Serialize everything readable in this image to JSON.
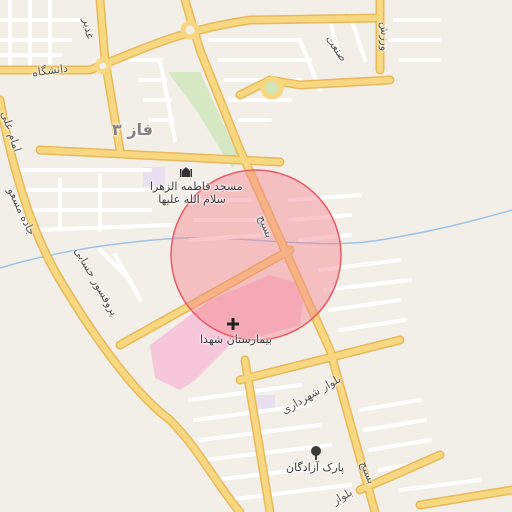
{
  "map": {
    "district": "فاز ۳",
    "streets": {
      "daneshgah": "دانشگاه",
      "ghadir": "غدیر",
      "sanat": "صنعت",
      "varzesh": "ورزش",
      "imam_ali": "امام علی",
      "masoudi_road": "جاده مسعو",
      "borujerdi": "پروفسور حسابی",
      "basij": "بسیج",
      "shahrdari": "بلوار شهرداری",
      "basij_south": "بسیج",
      "bolvar_south": "بلوار"
    },
    "pois": {
      "mosque_line1": "مسجد فاطمه الزهرا",
      "mosque_line2": "سلام الله علیها",
      "hospital": "بیمارستان شهدا",
      "park": "پارک آزادگان"
    },
    "colors": {
      "background": "#f2efe9",
      "major_road": "#f7d77f",
      "major_road_casing": "#e8b95a",
      "minor_road": "#ffffff",
      "minor_casing": "#d9d4cc",
      "highlight_circle_fill": "#f4868f",
      "highlight_circle_stroke": "#e85a66",
      "hospital_area": "#f6c6d9",
      "park_area": "#cfe5b8",
      "water": "#9cc3e6"
    },
    "icons": [
      "mosque-icon",
      "hospital-cross-icon",
      "park-tree-icon"
    ]
  }
}
